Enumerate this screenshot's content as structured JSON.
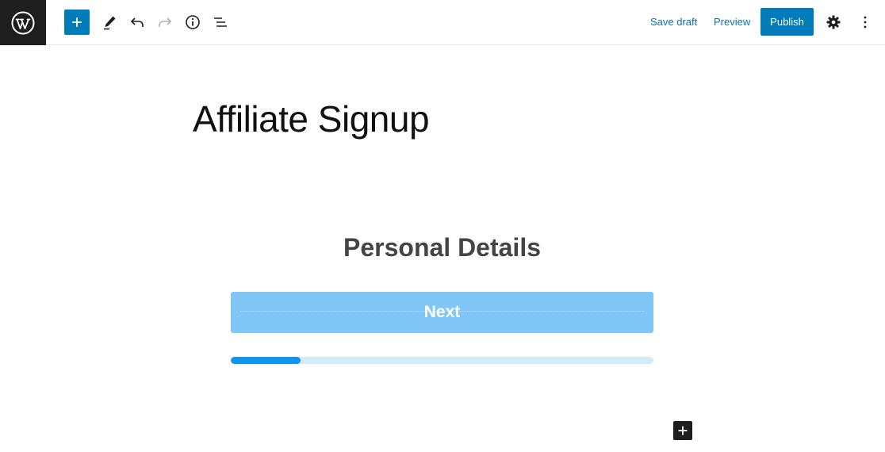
{
  "toolbar": {
    "icons": {
      "logo": "wordpress-icon",
      "add": "plus-icon",
      "tools": "pencil-icon",
      "undo": "undo-icon",
      "redo": "redo-icon",
      "details": "info-icon",
      "outline": "list-view-icon",
      "settings": "gear-icon",
      "options": "more-vertical-icon"
    },
    "save_draft_label": "Save draft",
    "preview_label": "Preview",
    "publish_label": "Publish"
  },
  "post": {
    "title": "Affiliate Signup"
  },
  "form": {
    "page_title": "Personal Details",
    "next_label": "Next",
    "progress_fraction": 0.165
  },
  "inserter": {
    "icon": "plus-icon"
  },
  "colors": {
    "accent": "#007cba",
    "next_button": "#80c6f6",
    "progress_fill": "#0f95ec",
    "progress_track": "#d4ebfc"
  }
}
